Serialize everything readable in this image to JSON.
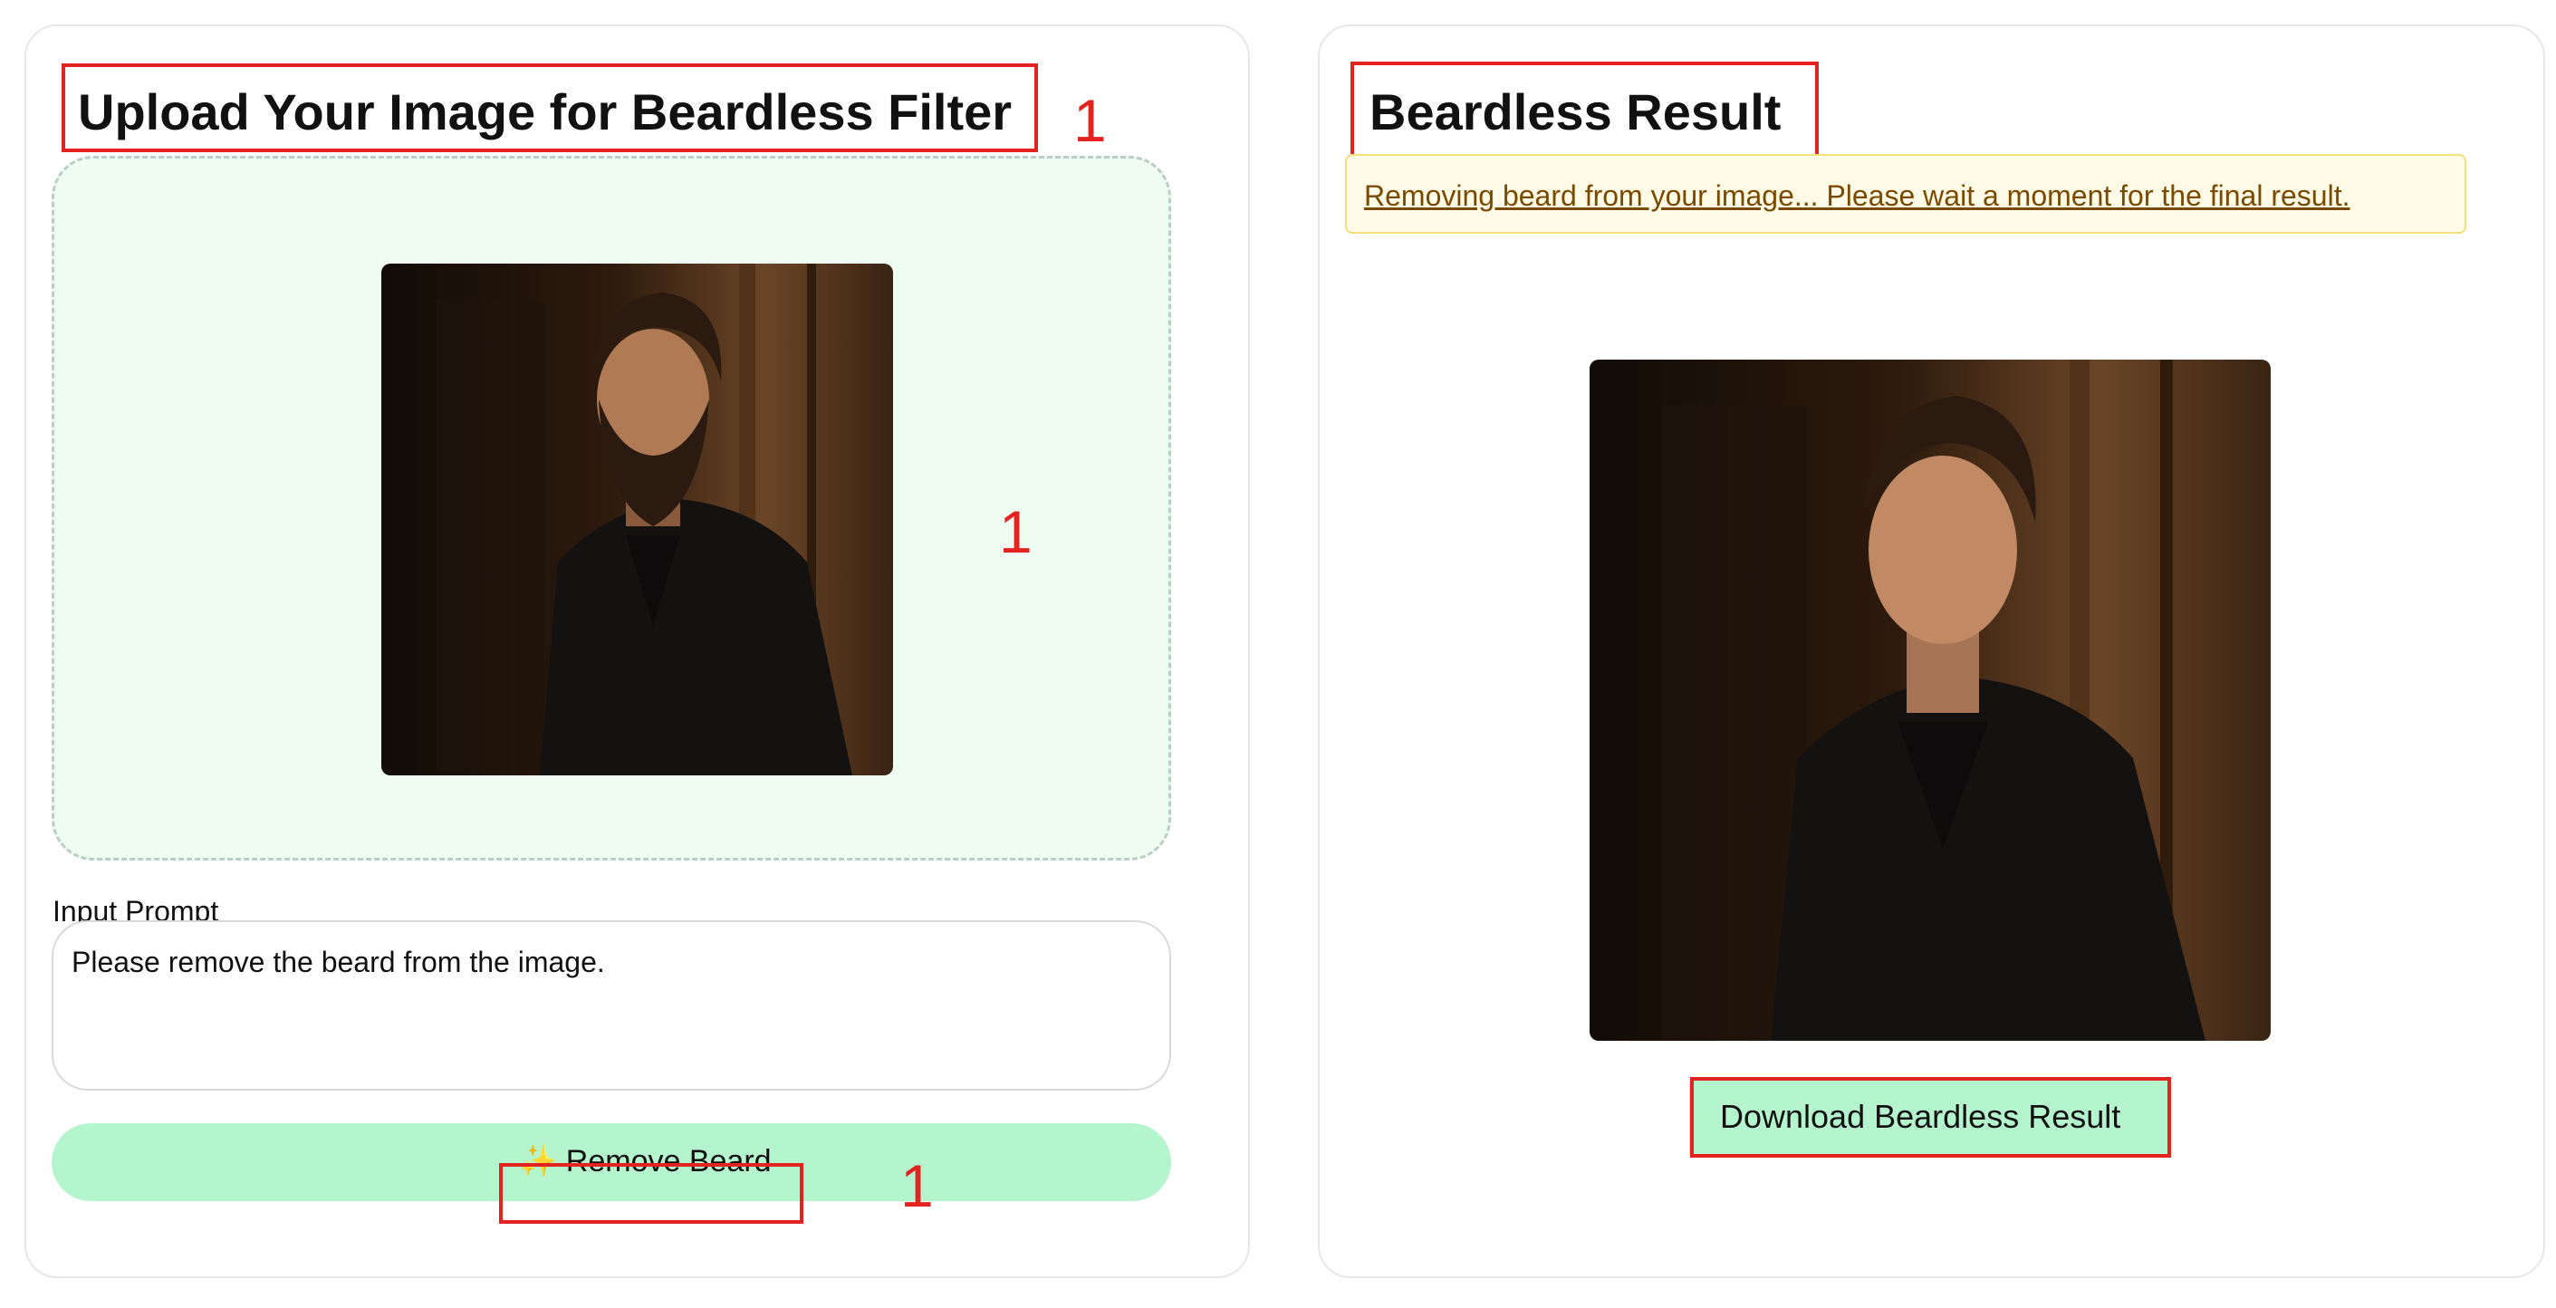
{
  "upload_panel": {
    "title": "Upload Your Image for Beardless Filter",
    "image_alt": "uploaded portrait with beard",
    "prompt_label": "Input Prompt",
    "prompt_value": "Please remove the beard from the image.",
    "remove_button_icon": "sparkle-icon",
    "remove_button_label": "Remove Beard",
    "sparkle_glyph": "✨"
  },
  "result_panel": {
    "title": "Beardless Result",
    "status_message": "Removing beard from your image... Please wait a moment for the final result.",
    "image_alt": "beardless result portrait",
    "download_label": "Download Beardless Result"
  },
  "annotations": {
    "title_marker": "1",
    "image_marker": "1",
    "button_marker": "1"
  },
  "colors": {
    "annotation": "#e3231f",
    "accent_green": "#b5f5ce",
    "dropzone_bg": "#effcf2",
    "status_bg": "#fffbe6",
    "status_text": "#7a4a00"
  }
}
